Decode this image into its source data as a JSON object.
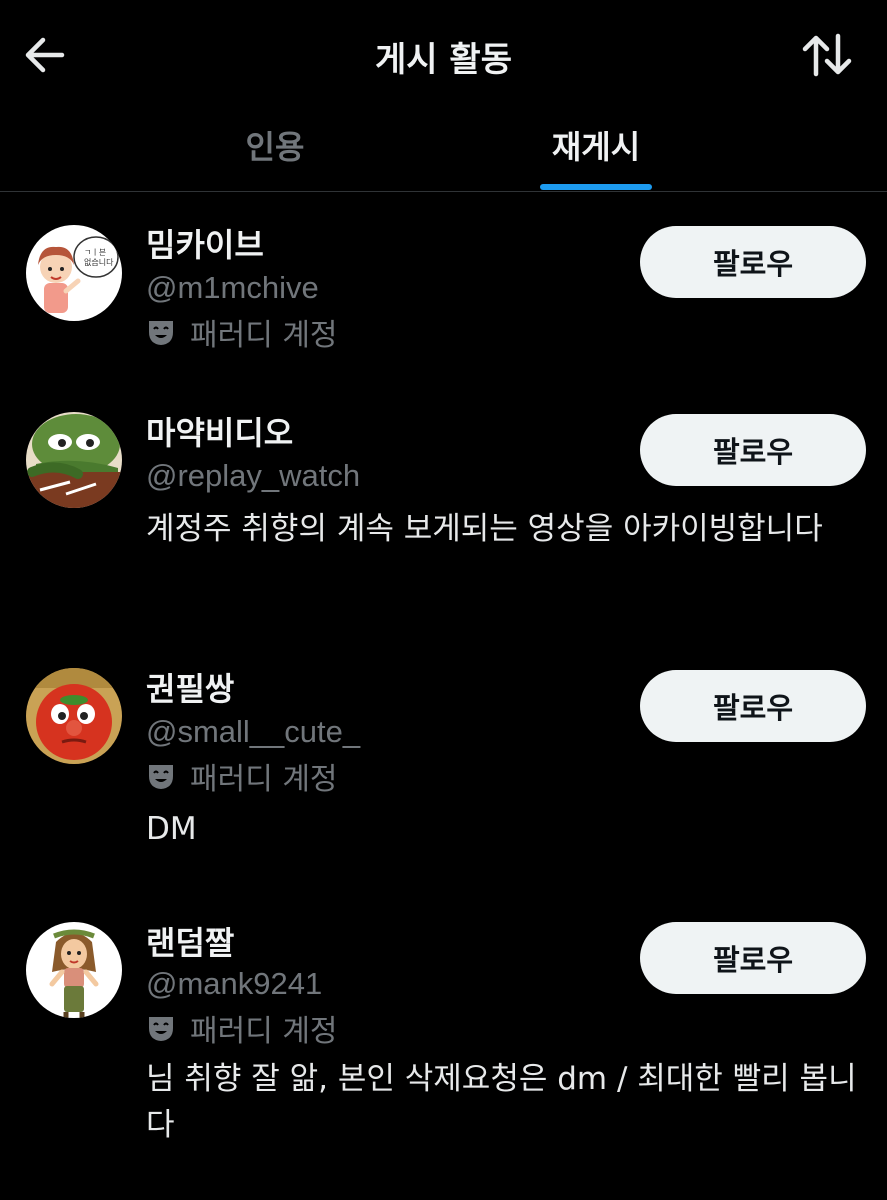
{
  "header": {
    "title": "게시 활동",
    "back_icon": "arrow-left-icon",
    "sort_icon": "sort-arrows-icon"
  },
  "tabs": [
    {
      "label": "인용",
      "active": false
    },
    {
      "label": "재게시",
      "active": true
    }
  ],
  "colors": {
    "accent": "#1d9bf0",
    "background": "#000000",
    "secondary_text": "#71767b",
    "button_bg": "#eff3f4"
  },
  "users": [
    {
      "name": "밈카이브",
      "handle": "@m1mchive",
      "badge": "패러디 계정",
      "bio": "",
      "follow_label": "팔로우"
    },
    {
      "name": "마약비디오",
      "handle": "@replay_watch",
      "badge": "",
      "bio": "계정주 취향의 계속 보게되는 영상을 아카이빙합니다",
      "follow_label": "팔로우"
    },
    {
      "name": "권필쌍",
      "handle": "@small__cute_",
      "badge": "패러디 계정",
      "bio": "DM",
      "follow_label": "팔로우"
    },
    {
      "name": "랜덤짤",
      "handle": "@mank9241",
      "badge": "패러디 계정",
      "bio": "님 취향 잘 앎, 본인 삭제요청은 dm / 최대한 빨리 봅니다",
      "follow_label": "팔로우"
    }
  ]
}
